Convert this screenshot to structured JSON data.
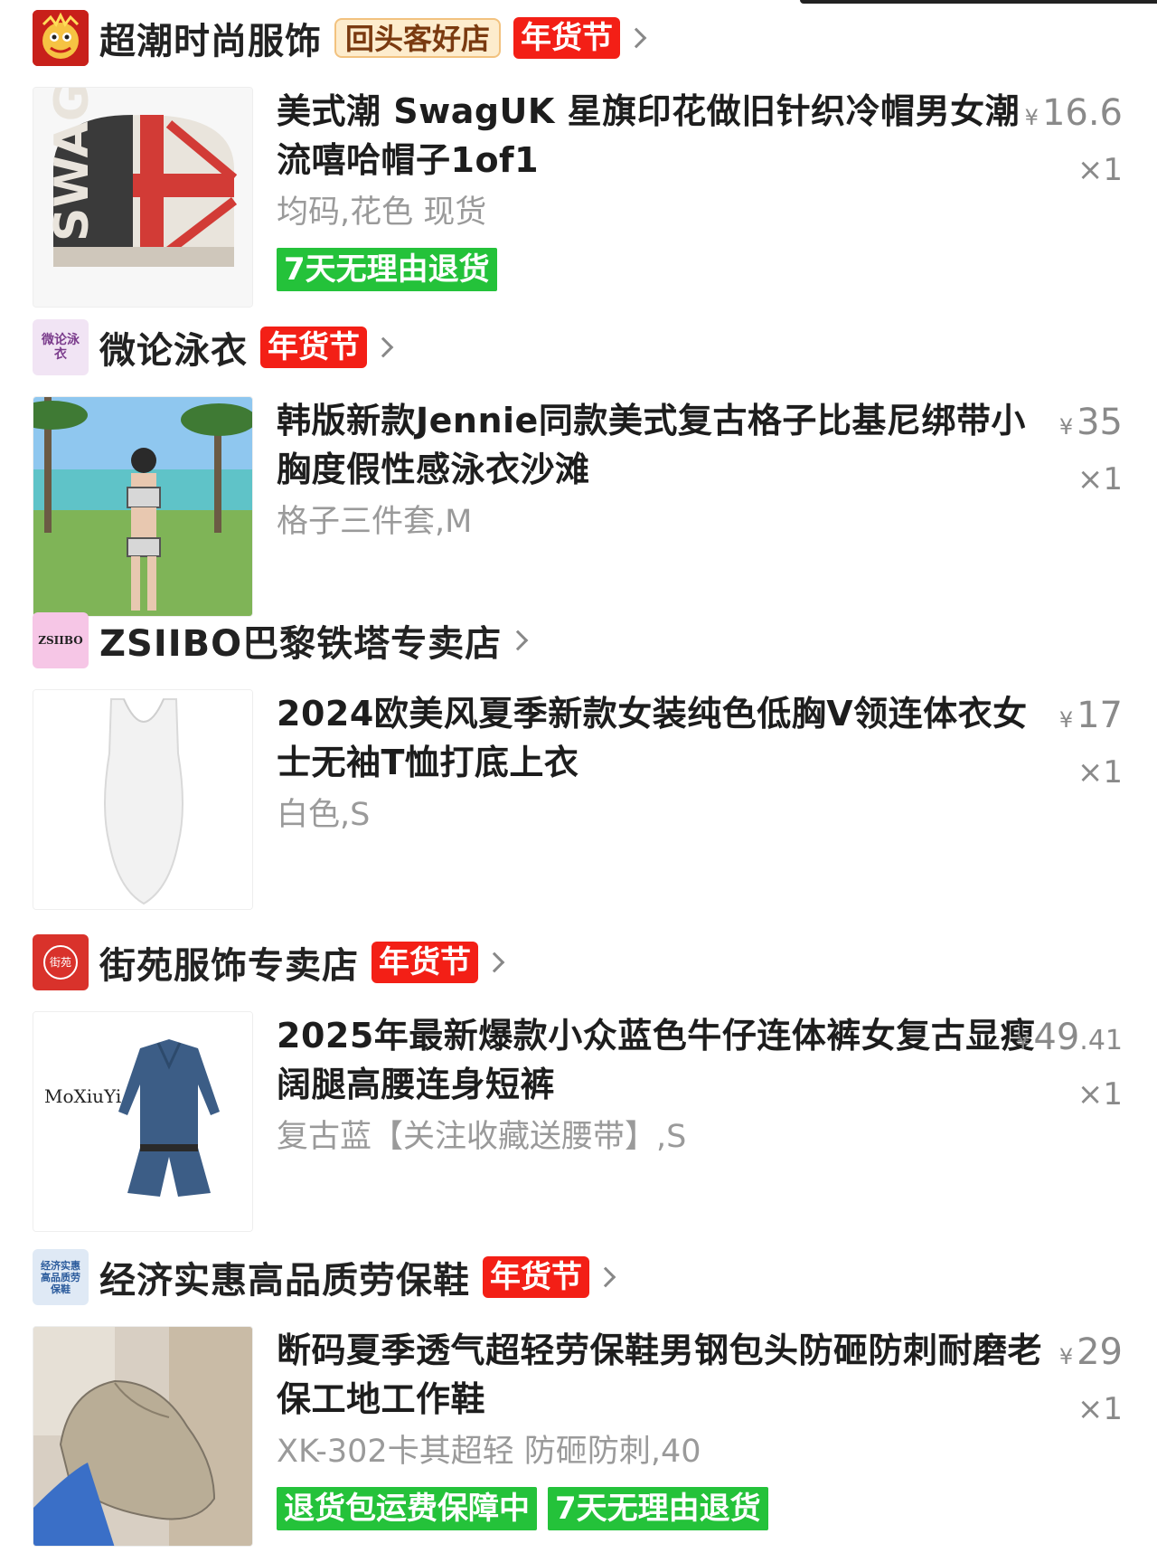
{
  "shops": [
    {
      "name": "超潮时尚服饰",
      "logo_text": "狮",
      "repeat_badge": "回头客好店",
      "festival_badge": "年货节",
      "product": {
        "title": "美式潮 SwagUK 星旗印花做旧针织冷帽男女潮流嘻哈帽子1of1",
        "spec": "均码,花色 现货",
        "currency": "¥",
        "price": "16.6",
        "qty": "×1",
        "tags": [
          "7天无理由退货"
        ]
      }
    },
    {
      "name": "微论泳衣",
      "logo_text": "微论泳衣",
      "festival_badge": "年货节",
      "product": {
        "title": "韩版新款Jennie同款美式复古格子比基尼绑带小胸度假性感泳衣沙滩",
        "spec": "格子三件套,M",
        "currency": "¥",
        "price": "35",
        "qty": "×1",
        "tags": []
      }
    },
    {
      "name": "ZSIIBO巴黎铁塔专卖店",
      "logo_text": "ZSIIBO",
      "product": {
        "title": "2024欧美风夏季新款女装纯色低胸V领连体衣女士无袖T恤打底上衣",
        "spec": "白色,S",
        "currency": "¥",
        "price": "17",
        "qty": "×1",
        "tags": []
      }
    },
    {
      "name": "街苑服饰专卖店",
      "logo_text": "街苑",
      "festival_badge": "年货节",
      "product": {
        "title": "2025年最新爆款小众蓝色牛仔连体裤女复古显瘦阔腿高腰连身短裤",
        "spec": "复古蓝【关注收藏送腰带】,S",
        "currency": "¥",
        "price_int": "49",
        "price_dec": ".41",
        "qty": "×1",
        "thumb_brand": "MoXiuYi",
        "tags": []
      }
    },
    {
      "name": "经济实惠高品质劳保鞋",
      "logo_text": "经济实惠高品质劳保鞋",
      "festival_badge": "年货节",
      "product": {
        "title": "断码夏季透气超轻劳保鞋男钢包头防砸防刺耐磨老保工地工作鞋",
        "spec": "XK-302卡其超轻 防砸防刺,40",
        "currency": "¥",
        "price": "29",
        "qty": "×1",
        "tags": [
          "退货包运费保障中",
          "7天无理由退货"
        ]
      }
    }
  ],
  "colors": {
    "festival_red": "#f31f16",
    "tag_green": "#24c23a",
    "repeat_bg": "#fdeccd"
  }
}
